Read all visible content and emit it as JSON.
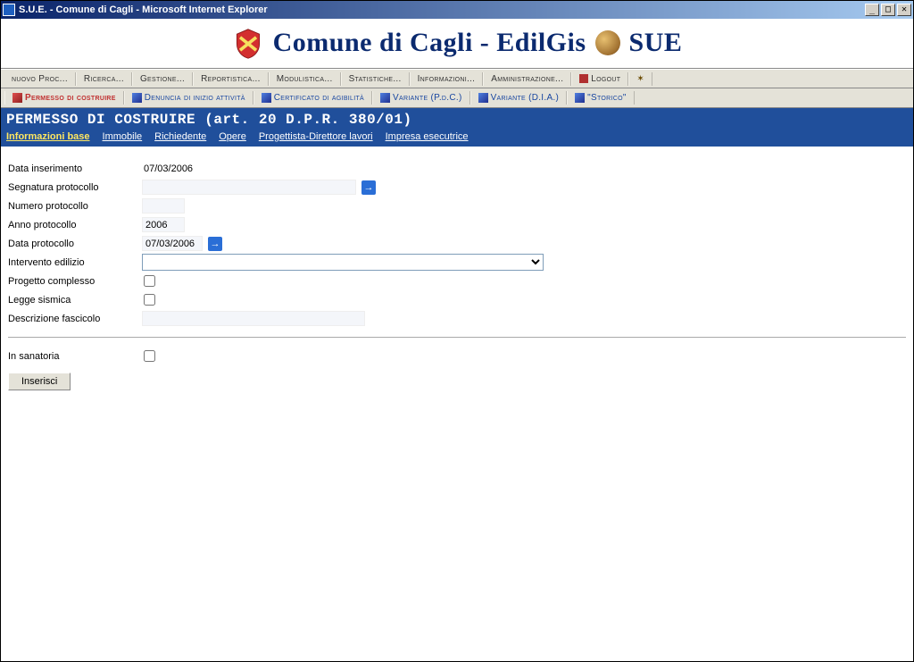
{
  "window": {
    "title": "S.U.E. - Comune di Cagli - Microsoft Internet Explorer"
  },
  "banner": {
    "text_before": "Comune di Cagli - EdilGis",
    "text_after": "SUE"
  },
  "menu": {
    "items": [
      "nuovo Proc...",
      "Ricerca...",
      "Gestione...",
      "Reportistica...",
      "Modulistica...",
      "Statistiche...",
      "Informazioni...",
      "Amministrazione..."
    ],
    "logout": "Logout"
  },
  "tabs": [
    {
      "label": "Permesso di costruire",
      "active": true
    },
    {
      "label": "Denuncia di inizio attività",
      "active": false
    },
    {
      "label": "Certificato di agibilità",
      "active": false
    },
    {
      "label": "Variante (P.d.C.)",
      "active": false
    },
    {
      "label": "Variante (D.I.A.)",
      "active": false
    },
    {
      "label": "\"Storico\"",
      "active": false
    }
  ],
  "page": {
    "title": "PERMESSO DI COSTRUIRE (art. 20 D.P.R. 380/01)",
    "subtabs": [
      {
        "label": "Informazioni base",
        "active": true
      },
      {
        "label": "Immobile"
      },
      {
        "label": "Richiedente"
      },
      {
        "label": "Opere"
      },
      {
        "label": "Progettista-Direttore lavori"
      },
      {
        "label": "Impresa esecutrice"
      }
    ]
  },
  "form": {
    "data_inserimento": {
      "label": "Data inserimento",
      "value": "07/03/2006"
    },
    "segnatura_protocollo": {
      "label": "Segnatura protocollo",
      "value": ""
    },
    "numero_protocollo": {
      "label": "Numero protocollo",
      "value": ""
    },
    "anno_protocollo": {
      "label": "Anno protocollo",
      "value": "2006"
    },
    "data_protocollo": {
      "label": "Data protocollo",
      "value": "07/03/2006"
    },
    "intervento_edilizio": {
      "label": "Intervento edilizio",
      "value": ""
    },
    "progetto_complesso": {
      "label": "Progetto complesso"
    },
    "legge_sismica": {
      "label": "Legge sismica"
    },
    "descrizione_fascicolo": {
      "label": "Descrizione fascicolo",
      "value": ""
    },
    "in_sanatoria": {
      "label": "In sanatoria"
    },
    "submit": "Inserisci"
  }
}
